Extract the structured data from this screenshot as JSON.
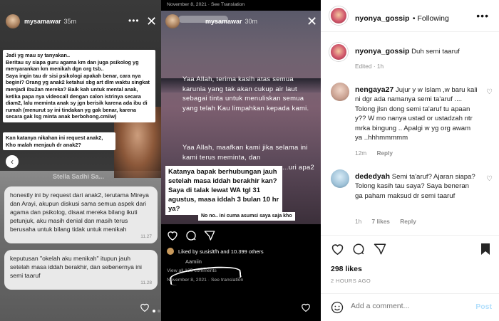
{
  "story_left": {
    "username": "mysamawar",
    "time": "35m",
    "question_text": "Jadi yg mau sy tanyakan..\nBeritau sy siapa guru agama km dan juga psikolog yg menyarankan km menikah dgn org tsb..\nSaya ingin tau dr sisi psikologi apakah benar, cara nya begini? Orang yg anak2 ketahui sbg art dlm waktu singkat menjadi ibu2an mereka? Baik kah untuk mental anak, ketika papa nya videocall dengan calon istrinya secara diam2, lalu meminta anak sy jgn berisik karena ada ibu di rumah (menurut sy ini tindakan yg gak benar, karena secara gak lsg minta anak berbohong.cmiiw)",
    "question2_text": "Kan katanya nikahan ini request anak2, Kho malah menjauh dr anak2?",
    "watermark": "Stella Sadhi Sa...",
    "bubble1_text": "honestly ini by request dari anak2, terutama Mireya dan Arayi, akupun diskusi sama semua aspek dari agama dan psikolog, disaat mereka bilang ikuti petunjuk, aku masih denial dan masih terus berusaha untuk bilang tidak untuk menikah",
    "bubble1_time": "11.27",
    "bubble2_text": "keputusan \"okelah aku menikah\" itupun jauh setelah masa iddah berakhir, dan sebenernya ini semi taaruf",
    "bubble2_time": "11.28"
  },
  "story_mid": {
    "top_meta": "November 8, 2021 · See Translation",
    "username": "mysamawar",
    "time": "30m",
    "prayer1": "Yaa Allah, terima kasih atas semua karunia yang tak akan cukup air laut sebagai tinta untuk menuliskan semua yang telah Kau limpahkan kepada kami.",
    "prayer2": "Yaa Allah, maafkan kami jika selama ini kami terus meminta, dan",
    "prayer2_tail": "...uri apa2",
    "box_text": "Katanya bapak berhubungan jauh setelah masa iddah berakhir kan? Saya di talak lewat WA tgl 31 agustus, masa iddah 3 bulan 10 hr ya?",
    "box2_text": "No no.. ini cuma asumsi saya saja kho",
    "liked_by": "Liked by susisltfh and 10.399 others",
    "comment_peek": "Aamiin",
    "view_all": "View all 135 comments",
    "footer_meta": "November 8, 2021 · See translation"
  },
  "post": {
    "username": "nyonya_gossip",
    "following_label": "Following",
    "caption": "Duh semi taaruf",
    "caption_meta": "Edited · 1h",
    "comments": [
      {
        "username": "nengaya27",
        "text": "Jujur y w Islam ,w baru kali ni dgr ada namanya semi ta'aruf .... Tolong jlsn dong semi ta'aruf tu apaan y?? W mo nanya ustad or ustadzah ntr mrka bingung .. Apalgi w yg org awam ya ..hhhmmmmm",
        "time": "12m",
        "reply_label": "Reply"
      },
      {
        "username": "dededyah",
        "text": "Semi ta'aruf? Ajaran siapa? Tolong kasih tau saya? Saya beneran ga paham maksud dr semi taaruf",
        "time": "1h",
        "likes": "7 likes",
        "reply_label": "Reply"
      }
    ],
    "likes_count": "298 likes",
    "date": "2 HOURS AGO",
    "add_comment_placeholder": "Add a comment...",
    "post_label": "Post"
  },
  "colors": {
    "link_blue_disabled": "#b2dffc",
    "meta_grey": "#8e8e8e",
    "text_dark": "#262626"
  }
}
